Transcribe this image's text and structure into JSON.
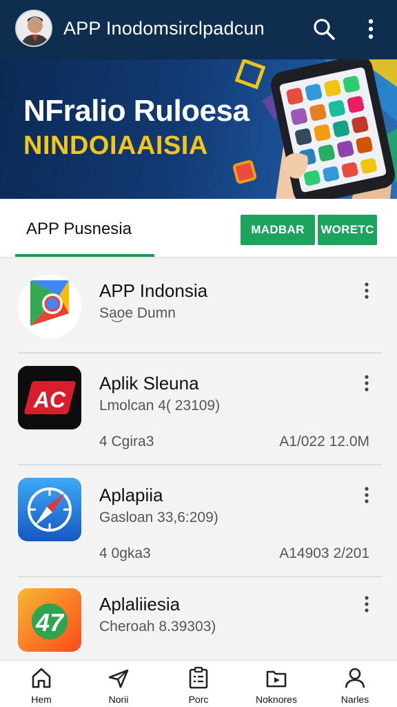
{
  "appbar": {
    "title": "APP Inodomsirclpadcun",
    "avatar_icon": "user-avatar-icon",
    "search_icon": "search-icon",
    "more_icon": "more-vert-icon",
    "background": "#0f2d4e"
  },
  "banner": {
    "line1": "NFralio Ruloesa",
    "line2": "NINDOIAAISIA",
    "line2_color": "#f4c61c",
    "art": "smartphone-in-hand"
  },
  "tabs": {
    "active_label": "APP Pusnesia",
    "chip1": "MADBAR",
    "chip2": "WORETC",
    "accent": "#1ea35f"
  },
  "apps": [
    {
      "name": "APP Indonsia",
      "subtitle": "Sa͜oe Dumn",
      "meta_left": "",
      "meta_right": "",
      "icon": "google-style-app-icon"
    },
    {
      "name": "Aplik Sleuna",
      "subtitle": "Lmolcan 4( 23109)",
      "meta_left": "4 Cgira3",
      "meta_right": "A1/022 12.0M",
      "icon": "ac-app-icon"
    },
    {
      "name": "Aplapiia",
      "subtitle": "Gasloan 33,6:209)",
      "meta_left": "4 0gka3",
      "meta_right": "A14903 2/201",
      "icon": "compass-app-icon"
    },
    {
      "name": "Aplaliiesia",
      "subtitle": "Cheroah 8.39303)",
      "meta_left": "",
      "meta_right": "",
      "icon": "47-app-icon"
    }
  ],
  "bottom_nav": [
    {
      "label": "Hem",
      "icon": "home-icon"
    },
    {
      "label": "Norii",
      "icon": "send-icon"
    },
    {
      "label": "Porc",
      "icon": "clipboard-icon"
    },
    {
      "label": "Noknores",
      "icon": "folder-icon"
    },
    {
      "label": "Narles",
      "icon": "person-icon"
    }
  ]
}
